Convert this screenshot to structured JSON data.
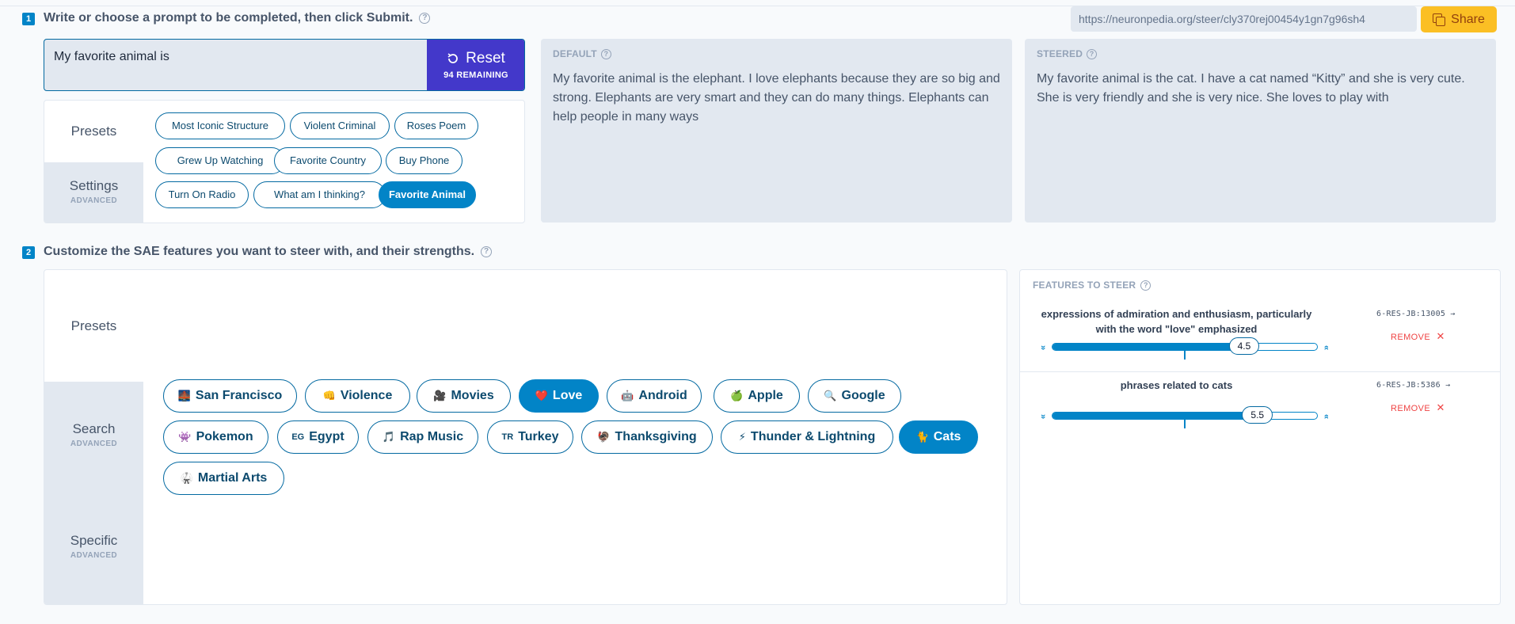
{
  "step1": {
    "number": "1",
    "title": "Write or choose a prompt to be completed, then click Submit."
  },
  "share": {
    "url": "https://neuronpedia.org/steer/cly370rej00454y1gn7g96sh4",
    "label": "Share"
  },
  "prompt": {
    "value": "My favorite animal is",
    "reset_label": "Reset",
    "remaining": "94 REMAINING"
  },
  "prompt_tabs": {
    "presets": "Presets",
    "settings": "Settings",
    "settings_sub": "ADVANCED"
  },
  "prompt_presets": [
    {
      "label": "Most Iconic Structure",
      "active": false
    },
    {
      "label": "Violent Criminal",
      "active": false
    },
    {
      "label": "Roses Poem",
      "active": false
    },
    {
      "label": "Grew Up Watching",
      "active": false
    },
    {
      "label": "Favorite Country",
      "active": false
    },
    {
      "label": "Buy Phone",
      "active": false
    },
    {
      "label": "Turn On Radio",
      "active": false
    },
    {
      "label": "What am I thinking?",
      "active": false
    },
    {
      "label": "Favorite Animal",
      "active": true
    }
  ],
  "outputs": {
    "default_label": "DEFAULT",
    "default_text": "My favorite animal is the elephant. I love elephants because they are so big and strong. Elephants are very smart and they can do many things. Elephants can help people in many ways",
    "steered_label": "STEERED",
    "steered_text": "My favorite animal is the cat. I have a cat named “Kitty” and she is very cute. She is very friendly and she is very nice. She loves to play with"
  },
  "step2": {
    "number": "2",
    "title": "Customize the SAE features you want to steer with, and their strengths."
  },
  "feature_tabs": {
    "presets": "Presets",
    "search": "Search",
    "search_sub": "ADVANCED",
    "specific": "Specific",
    "specific_sub": "ADVANCED"
  },
  "feature_presets": [
    {
      "label": "San Francisco",
      "icon": "🌉",
      "active": false
    },
    {
      "label": "Violence",
      "icon": "👊",
      "active": false
    },
    {
      "label": "Movies",
      "icon": "🎥",
      "active": false
    },
    {
      "label": "Love",
      "icon": "❤️",
      "active": true
    },
    {
      "label": "Android",
      "icon": "🤖",
      "active": false
    },
    {
      "label": "Apple",
      "icon": "🍏",
      "active": false
    },
    {
      "label": "Google",
      "icon": "🔍",
      "active": false
    },
    {
      "label": "Pokemon",
      "icon": "👾",
      "active": false
    },
    {
      "label": "Egypt",
      "icon": "EG",
      "active": false
    },
    {
      "label": "Rap Music",
      "icon": "🎵",
      "active": false
    },
    {
      "label": "Turkey",
      "icon": "TR",
      "active": false
    },
    {
      "label": "Thanksgiving",
      "icon": "🦃",
      "active": false
    },
    {
      "label": "Thunder & Lightning",
      "icon": "⚡",
      "active": false
    },
    {
      "label": "Cats",
      "icon": "🐈",
      "active": true
    },
    {
      "label": "Martial Arts",
      "icon": "🥋",
      "active": false
    }
  ],
  "steer": {
    "heading": "FEATURES TO STEER",
    "remove_label": "REMOVE",
    "features": [
      {
        "description": "expressions of admiration and enthusiasm, particularly with the word \"love\" emphasized",
        "code": "6-RES-JB:13005 →",
        "strength": "4.5",
        "strength_value": 4.5
      },
      {
        "description": "phrases related to cats",
        "code": "6-RES-JB:5386 →",
        "strength": "5.5",
        "strength_value": 5.5
      }
    ]
  },
  "colors": {
    "accent": "#0284c7",
    "reset": "#4338ca",
    "share": "#fbbf24",
    "remove": "#ef4444"
  }
}
